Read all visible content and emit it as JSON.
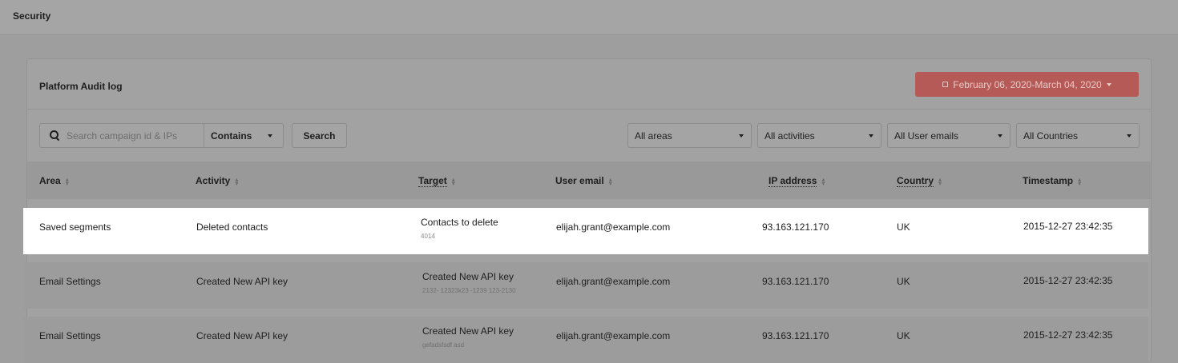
{
  "page": {
    "title": "Security"
  },
  "card": {
    "title": "Platform Audit log",
    "date_range": "February 06, 2020-March 04, 2020"
  },
  "toolbar": {
    "search_placeholder": "Search campaign id & IPs",
    "match_mode": "Contains",
    "search_label": "Search",
    "filters": {
      "areas": "All areas",
      "activities": "All activities",
      "emails": "All User emails",
      "countries": "All Countries"
    }
  },
  "table": {
    "headers": {
      "area": "Area",
      "activity": "Activity",
      "target": "Target",
      "email": "User email",
      "ip": "IP address",
      "country": "Country",
      "timestamp": "Timestamp"
    },
    "rows": [
      {
        "area": "Saved segments",
        "activity": "Deleted contacts",
        "target": "Contacts to delete",
        "target_sub": "4014",
        "email": "elijah.grant@example.com",
        "ip": "93.163.121.170",
        "country": "UK",
        "timestamp": "2015-12-27 23:42:35"
      },
      {
        "area": "Email Settings",
        "activity": "Created New API key",
        "target": "Created New API key",
        "target_sub": "2132- 12323k23 -1239 123-2130",
        "email": "elijah.grant@example.com",
        "ip": "93.163.121.170",
        "country": "UK",
        "timestamp": "2015-12-27 23:42:35"
      },
      {
        "area": "Email Settings",
        "activity": "Created New API key",
        "target": "Created New API key",
        "target_sub": "gefadsfsdf asd",
        "email": "elijah.grant@example.com",
        "ip": "93.163.121.170",
        "country": "UK",
        "timestamp": "2015-12-27 23:42:35"
      }
    ]
  },
  "colors": {
    "accent": "#b55a57",
    "highlight_row": "#ffffff",
    "overlay": "#9e9e9e"
  }
}
